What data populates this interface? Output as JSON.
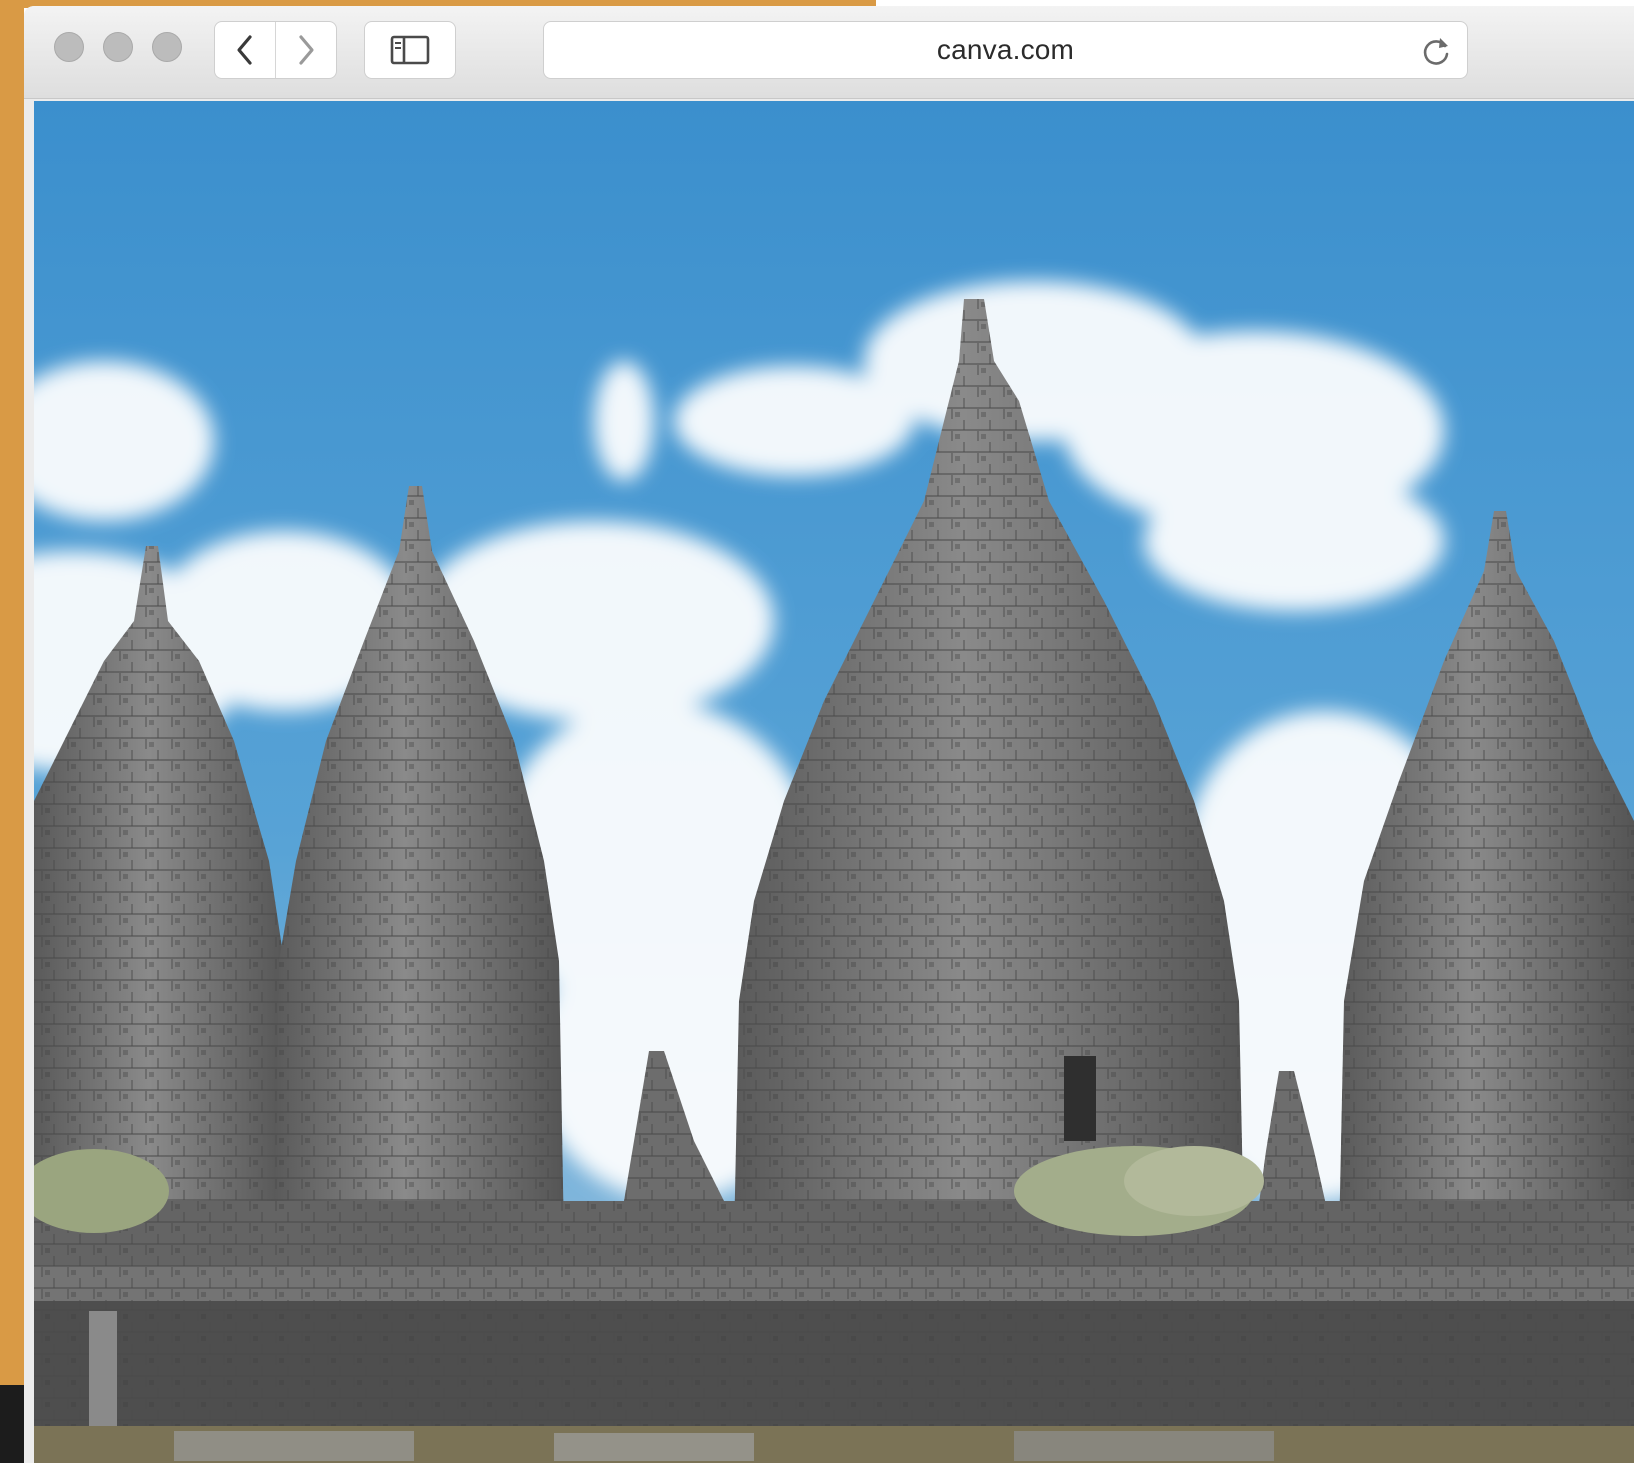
{
  "browser": {
    "url": "canva.com",
    "traffic_lights": [
      "close",
      "minimize",
      "maximize"
    ],
    "icons": {
      "back": "chevron-left-icon",
      "forward": "chevron-right-icon",
      "sidebar": "sidebar-icon",
      "reload": "reload-icon"
    }
  },
  "colors": {
    "backdrop": "#d99a45",
    "sky": "#3d93cf",
    "stone": "#6f6f6f"
  }
}
